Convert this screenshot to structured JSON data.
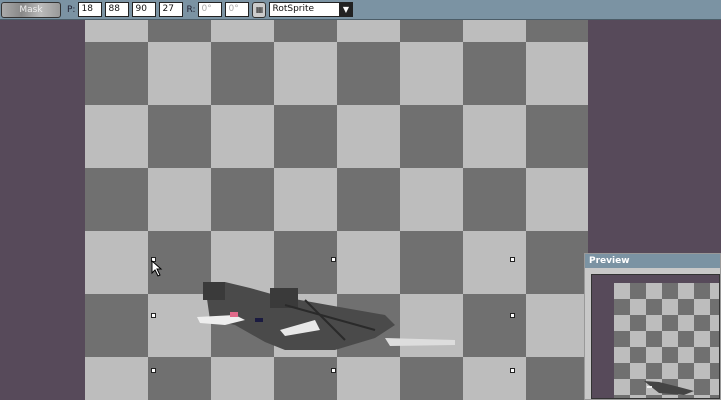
{
  "toolbar": {
    "mask_label": "Mask",
    "p_label": "P:",
    "p_values": [
      "18",
      "88",
      "90",
      "27"
    ],
    "r_label": "R:",
    "r_values": [
      "0°",
      "0°"
    ],
    "algorithm": "RotSprite"
  },
  "preview": {
    "title": "Preview"
  },
  "colors": {
    "background": "#574a5a",
    "checker_light": "#bdbdbd",
    "checker_dark": "#707070",
    "toolbar": "#7b93a3"
  }
}
